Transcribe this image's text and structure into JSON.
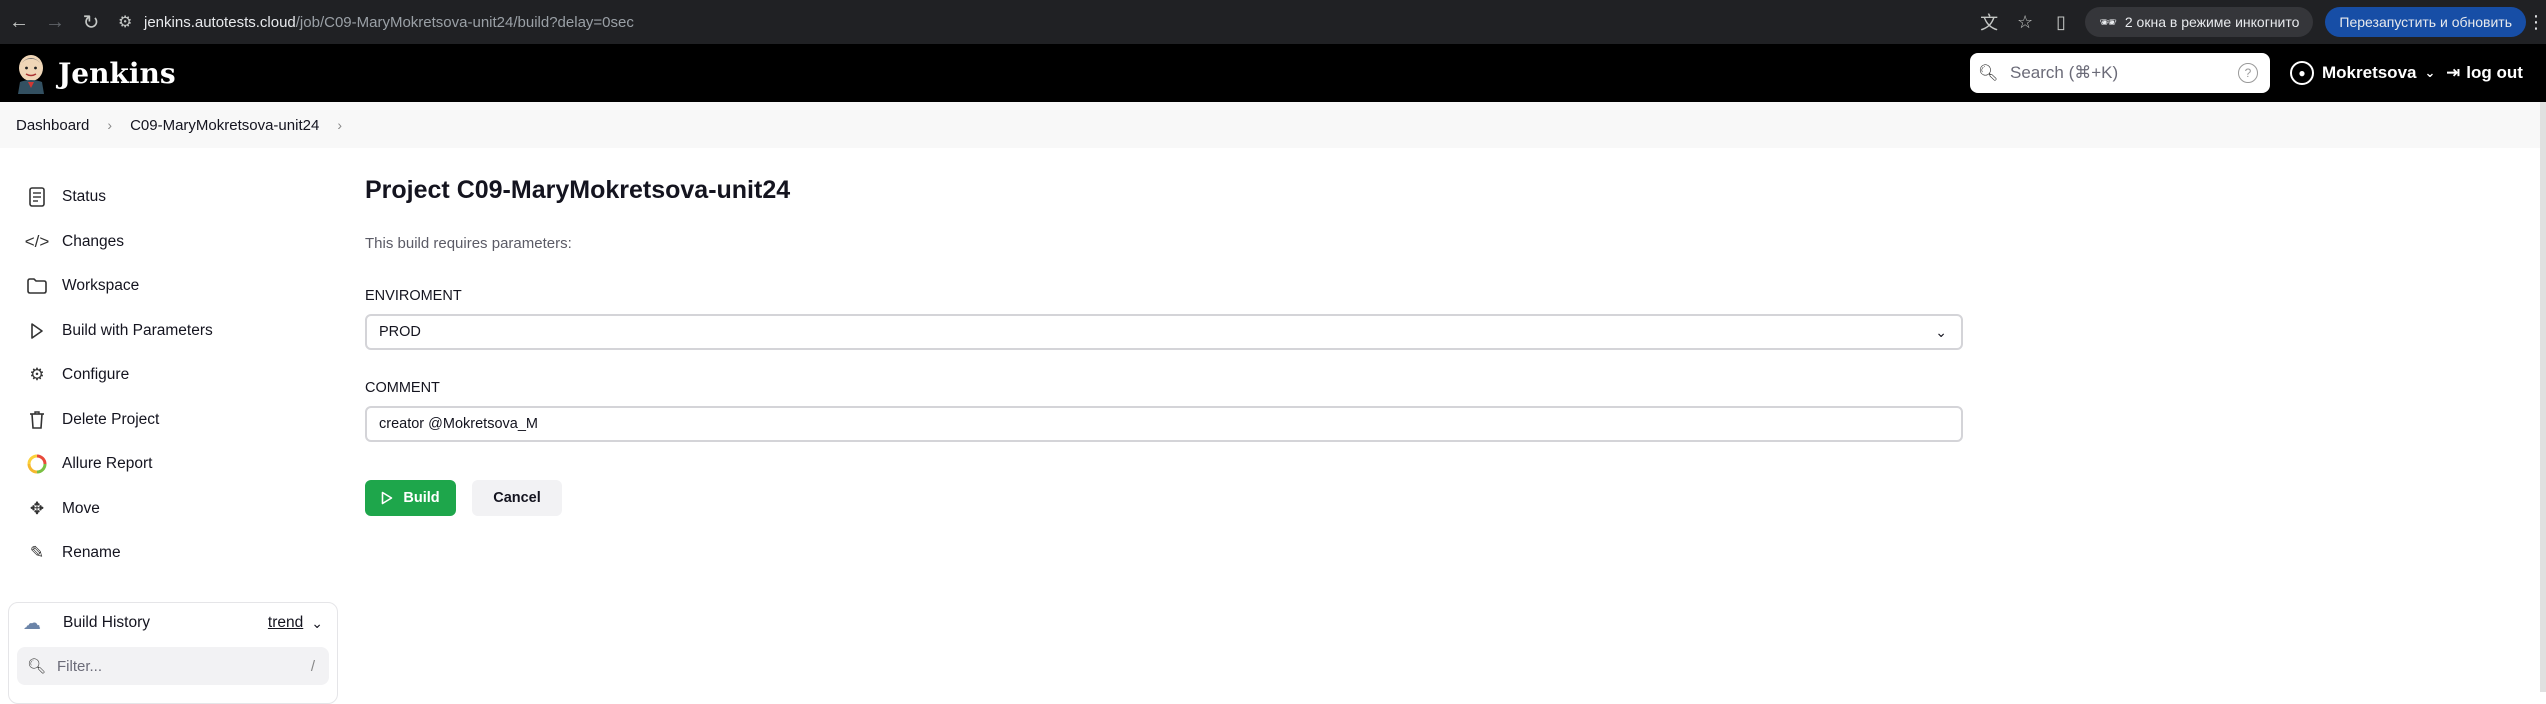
{
  "browser": {
    "url_host": "jenkins.autotests.cloud",
    "url_path": "/job/C09-MaryMokretsova-unit24/build?delay=0sec",
    "incognito_label": "2 окна в режиме инкогнито",
    "relaunch_label": "Перезапустить и обновить"
  },
  "header": {
    "brand": "Jenkins",
    "search_placeholder": "Search (⌘+K)",
    "user_name": "Mokretsova",
    "logout_label": "log out"
  },
  "breadcrumb": {
    "items": [
      "Dashboard",
      "C09-MaryMokretsova-unit24"
    ]
  },
  "sidebar": {
    "items": [
      {
        "label": "Status",
        "icon": "document-icon"
      },
      {
        "label": "Changes",
        "icon": "code-icon"
      },
      {
        "label": "Workspace",
        "icon": "folder-icon"
      },
      {
        "label": "Build with Parameters",
        "icon": "play-icon"
      },
      {
        "label": "Configure",
        "icon": "gear-icon"
      },
      {
        "label": "Delete Project",
        "icon": "trash-icon"
      },
      {
        "label": "Allure Report",
        "icon": "allure-icon"
      },
      {
        "label": "Move",
        "icon": "move-icon"
      },
      {
        "label": "Rename",
        "icon": "pencil-icon"
      }
    ]
  },
  "build_history": {
    "title": "Build History",
    "trend_label": "trend",
    "filter_placeholder": "Filter...",
    "filter_shortcut": "/"
  },
  "main": {
    "title": "Project C09-MaryMokretsova-unit24",
    "note": "This build requires parameters:",
    "params": [
      {
        "label": "ENVIROMENT",
        "value": "PROD"
      },
      {
        "label": "COMMENT",
        "value": "creator @Mokretsova_M"
      }
    ],
    "build_label": "Build",
    "cancel_label": "Cancel"
  },
  "colors": {
    "build_button": "#1ea64b",
    "header_bg": "#000000",
    "chrome_bg": "#202124"
  }
}
